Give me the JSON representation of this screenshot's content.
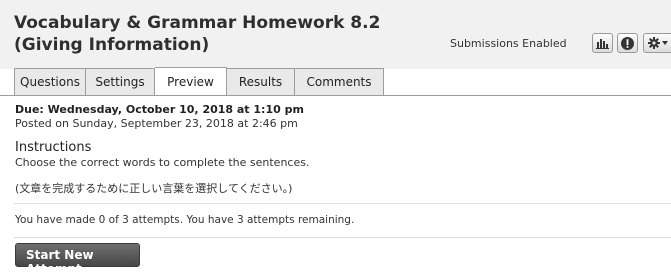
{
  "header": {
    "title": "Vocabulary & Grammar Homework 8.2 (Giving Information)",
    "status": "Submissions Enabled",
    "icons": [
      "bar-chart-icon",
      "info-icon",
      "gear-icon",
      "caret-down-icon"
    ]
  },
  "tabs": [
    {
      "label": "Questions",
      "active": false
    },
    {
      "label": "Settings",
      "active": false
    },
    {
      "label": "Preview",
      "active": true
    },
    {
      "label": "Results",
      "active": false
    },
    {
      "label": "Comments",
      "active": false
    }
  ],
  "details": {
    "due": "Due: Wednesday, October 10, 2018 at 1:10 pm",
    "posted": "Posted on Sunday, September 23, 2018 at 2:46 pm"
  },
  "instructions": {
    "heading": "Instructions",
    "text": "Choose the correct words to complete the sentences.",
    "text_jp": "(文章を完成するために正しい言葉を選択してください。)"
  },
  "attempts": {
    "text": "You have made 0 of 3 attempts. You have 3 attempts remaining."
  },
  "actions": {
    "start_label": "Start New Attempt"
  }
}
